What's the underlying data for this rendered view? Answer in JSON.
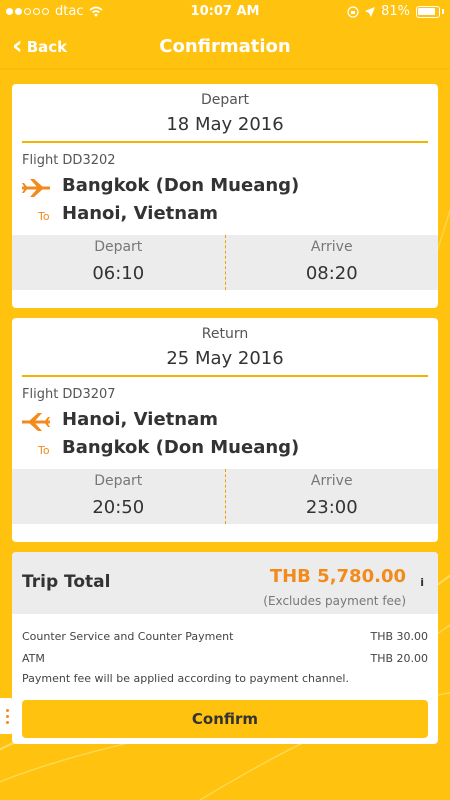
{
  "status_bar": {
    "carrier": "dtac",
    "time": "10:07 AM",
    "battery": "81%"
  },
  "nav": {
    "back_label": "Back",
    "title": "Confirmation"
  },
  "depart_trip": {
    "section_label": "Depart",
    "date": "18 May 2016",
    "flight": "Flight DD3202",
    "from": "Bangkok (Don Mueang)",
    "to_label": "To",
    "to": "Hanoi, Vietnam",
    "depart_label": "Depart",
    "depart_time": "06:10",
    "arrive_label": "Arrive",
    "arrive_time": "08:20"
  },
  "return_trip": {
    "section_label": "Return",
    "date": "25 May 2016",
    "flight": "Flight DD3207",
    "from": "Hanoi, Vietnam",
    "to_label": "To",
    "to": "Bangkok (Don Mueang)",
    "depart_label": "Depart",
    "depart_time": "20:50",
    "arrive_label": "Arrive",
    "arrive_time": "23:00"
  },
  "total": {
    "label": "Trip Total",
    "amount": "THB 5,780.00",
    "info": "i",
    "note": "(Excludes payment fee)",
    "fees": [
      {
        "name": "Counter Service and Counter Payment",
        "amount": "THB 30.00"
      },
      {
        "name": "ATM",
        "amount": "THB 20.00"
      }
    ],
    "fee_note": "Payment fee will be applied according to payment channel.",
    "confirm_label": "Confirm"
  },
  "colors": {
    "brand_yellow": "#ffc20e",
    "accent_orange": "#f28b1c",
    "band_gray": "#ececec"
  },
  "icons": {
    "plane": "plane-icon",
    "back": "chevron-left-icon",
    "wifi": "wifi-icon",
    "location": "location-arrow-icon",
    "lock": "orientation-lock-icon",
    "battery": "battery-icon",
    "info": "info-icon"
  }
}
